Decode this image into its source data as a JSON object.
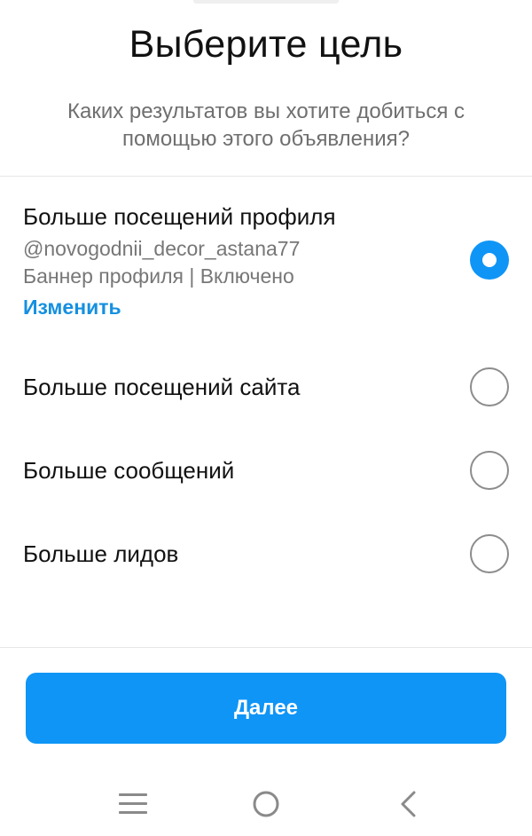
{
  "header": {
    "title": "Выберите цель",
    "subtitle": "Каких результатов вы хотите добиться с помощью этого объявления?"
  },
  "options": [
    {
      "title": "Больше посещений профиля",
      "handle": "@novogodnii_decor_astana77",
      "banner": "Баннер профиля | Включено",
      "edit_label": "Изменить",
      "selected": true
    },
    {
      "title": "Больше посещений сайта",
      "selected": false
    },
    {
      "title": "Больше сообщений",
      "selected": false
    },
    {
      "title": "Больше лидов",
      "selected": false
    }
  ],
  "footer": {
    "next_label": "Далее"
  },
  "navbar": {
    "icons": [
      "menu-icon",
      "home-circle-icon",
      "back-chevron-icon"
    ]
  },
  "colors": {
    "accent": "#0f95f6",
    "link": "#1590e0",
    "text_primary": "#111111",
    "text_secondary": "#777777"
  }
}
